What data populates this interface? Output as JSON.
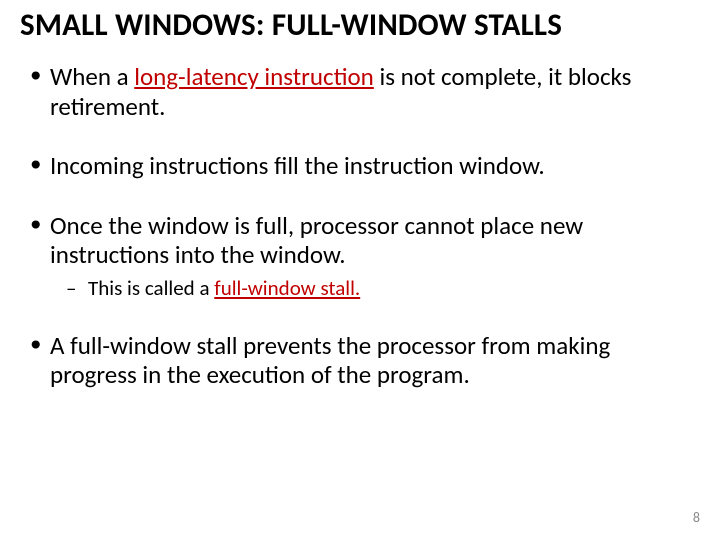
{
  "title": "SMALL WINDOWS: FULL-WINDOW STALLS",
  "bullets": [
    {
      "pre": "When a ",
      "hl": "long-latency instruction",
      "post": " is not complete, it blocks retirement."
    },
    {
      "text": "Incoming instructions fill the instruction window."
    },
    {
      "text": "Once the window is full, processor cannot place new instructions into the window.",
      "sub": {
        "pre": "This is called a ",
        "hl": "full-window stall."
      }
    },
    {
      "text": "A full-window stall prevents the processor from making progress in the execution of the program."
    }
  ],
  "page_number": "8"
}
